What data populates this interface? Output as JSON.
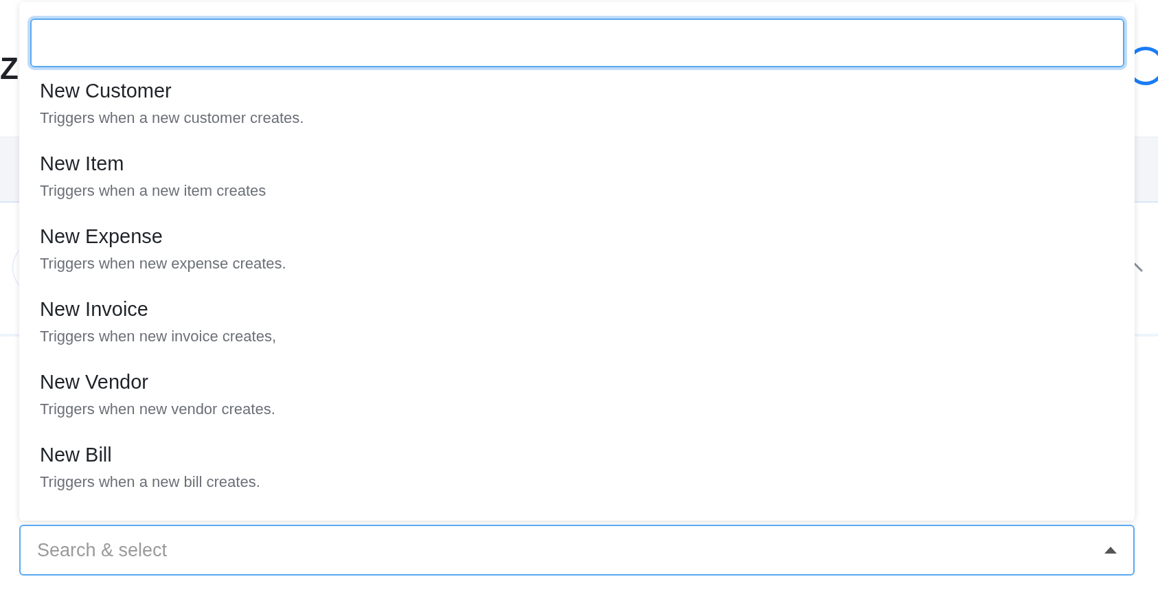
{
  "page_heading": "Z",
  "options": [
    {
      "title": "New Customer",
      "description": "Triggers when a new customer creates."
    },
    {
      "title": "New Item",
      "description": "Triggers when a new item creates"
    },
    {
      "title": "New Expense",
      "description": "Triggers when new expense creates."
    },
    {
      "title": "New Invoice",
      "description": "Triggers when new invoice creates,"
    },
    {
      "title": "New Vendor",
      "description": "Triggers when new vendor creates."
    },
    {
      "title": "New Bill",
      "description": "Triggers when a new bill creates."
    }
  ],
  "select": {
    "placeholder": "Search & select",
    "expanded": true
  }
}
